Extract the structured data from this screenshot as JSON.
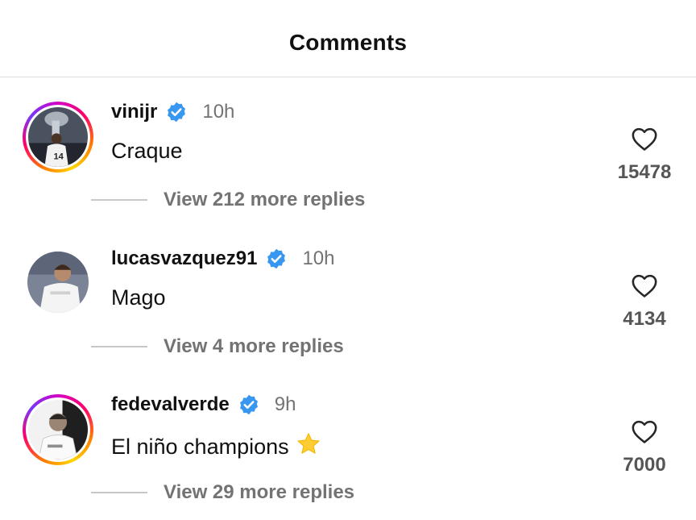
{
  "header": {
    "title": "Comments"
  },
  "comments": [
    {
      "username": "vinijr",
      "verified": true,
      "time": "10h",
      "text": "Craque",
      "likes": "15478",
      "replies": "View 212 more replies",
      "story_ring": true
    },
    {
      "username": "lucasvazquez91",
      "verified": true,
      "time": "10h",
      "text": "Mago",
      "likes": "4134",
      "replies": "View 4 more replies",
      "story_ring": false
    },
    {
      "username": "fedevalverde",
      "verified": true,
      "time": "9h",
      "text": "El niño champions",
      "emoji": "star",
      "likes": "7000",
      "replies": "View 29 more replies",
      "story_ring": true
    }
  ],
  "colors": {
    "verified_badge": "#3897f0",
    "muted_text": "#737373",
    "divider": "#dbdbdb",
    "star": "#ffcc33"
  }
}
